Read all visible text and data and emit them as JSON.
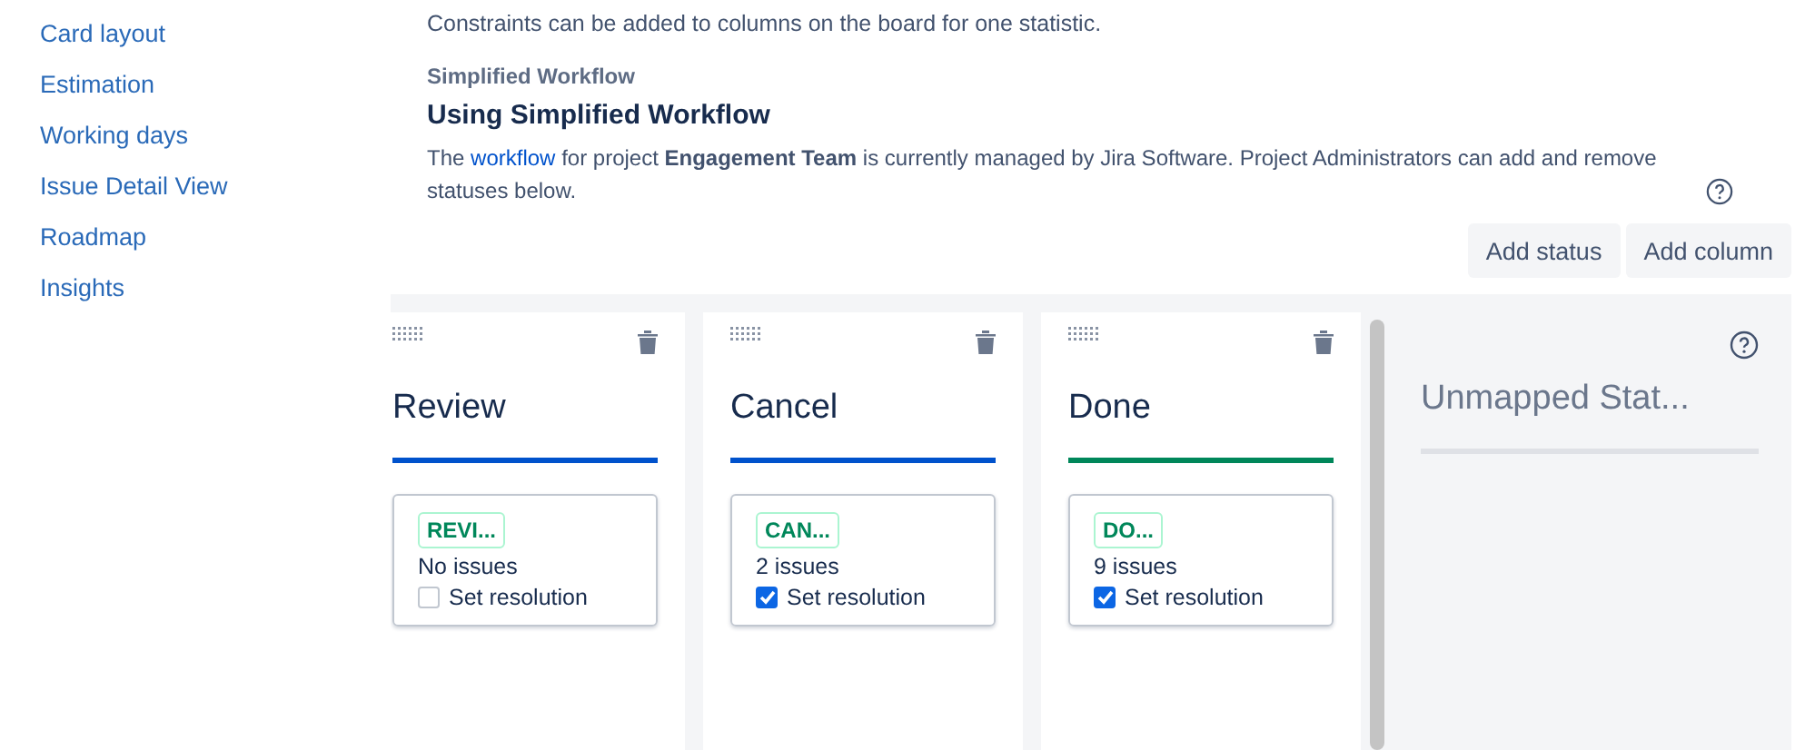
{
  "sidebar": {
    "items": [
      {
        "label": "Card layout"
      },
      {
        "label": "Estimation"
      },
      {
        "label": "Working days"
      },
      {
        "label": "Issue Detail View"
      },
      {
        "label": "Roadmap"
      },
      {
        "label": "Insights"
      }
    ]
  },
  "intro": "Constraints can be added to columns on the board for one statistic.",
  "workflow": {
    "label": "Simplified Workflow",
    "heading": "Using Simplified Workflow",
    "before": "The",
    "link": "workflow",
    "after": "for project **Engagement Team** is currently managed by Jira Software. Project Administrators can add and remove statuses below."
  },
  "buttons": [
    "Add status",
    "Add column"
  ],
  "columns": [
    {
      "title": "Review",
      "color": "#0052cc",
      "status": "REVI...",
      "count": "No issues",
      "resolution": "Set resolution",
      "checked": false
    },
    {
      "title": "Cancel",
      "color": "#0052cc",
      "status": "CAN...",
      "count": "2 issues",
      "resolution": "Set resolution",
      "checked": true
    },
    {
      "title": "Done",
      "color": "#00875a",
      "status": "DO...",
      "count": "9 issues",
      "resolution": "Set resolution",
      "checked": true
    }
  ],
  "unmapped": {
    "title": "Unmapped Stat..."
  }
}
